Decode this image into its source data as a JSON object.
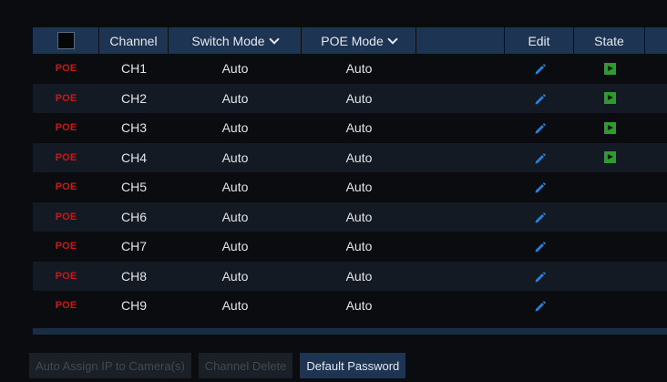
{
  "header": {
    "channel": "Channel",
    "switch_mode": "Switch Mode",
    "poe_mode": "POE Mode",
    "edit": "Edit",
    "state": "State"
  },
  "rows": [
    {
      "poe": "POE",
      "channel": "CH1",
      "switch_mode": "Auto",
      "poe_mode": "Auto",
      "state": "playing"
    },
    {
      "poe": "POE",
      "channel": "CH2",
      "switch_mode": "Auto",
      "poe_mode": "Auto",
      "state": "playing"
    },
    {
      "poe": "POE",
      "channel": "CH3",
      "switch_mode": "Auto",
      "poe_mode": "Auto",
      "state": "playing"
    },
    {
      "poe": "POE",
      "channel": "CH4",
      "switch_mode": "Auto",
      "poe_mode": "Auto",
      "state": "playing"
    },
    {
      "poe": "POE",
      "channel": "CH5",
      "switch_mode": "Auto",
      "poe_mode": "Auto",
      "state": ""
    },
    {
      "poe": "POE",
      "channel": "CH6",
      "switch_mode": "Auto",
      "poe_mode": "Auto",
      "state": ""
    },
    {
      "poe": "POE",
      "channel": "CH7",
      "switch_mode": "Auto",
      "poe_mode": "Auto",
      "state": ""
    },
    {
      "poe": "POE",
      "channel": "CH8",
      "switch_mode": "Auto",
      "poe_mode": "Auto",
      "state": ""
    },
    {
      "poe": "POE",
      "channel": "CH9",
      "switch_mode": "Auto",
      "poe_mode": "Auto",
      "state": ""
    }
  ],
  "buttons": {
    "auto_assign": "Auto Assign IP to Camera(s)",
    "channel_delete": "Channel Delete",
    "default_password": "Default Password"
  },
  "colors": {
    "header_bg": "#1d3553",
    "poe_red": "#c81818",
    "edit_blue": "#2b7fd8",
    "state_green": "#2f9a2f"
  },
  "icons": {
    "edit": "pencil-icon",
    "state": "play-icon",
    "header_checkbox": "checkbox-icon",
    "dropdown": "chevron-down-icon"
  }
}
